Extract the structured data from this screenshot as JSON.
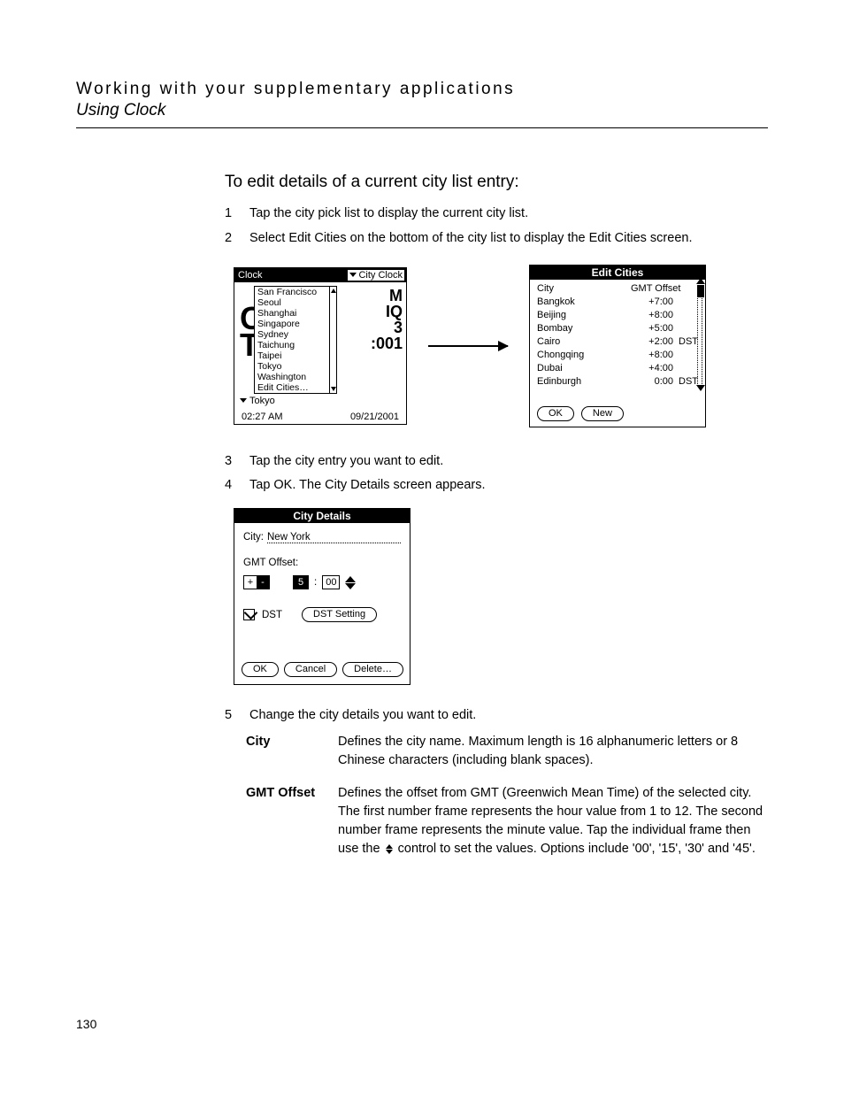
{
  "header": {
    "title": "Working with your supplementary applications",
    "subtitle": "Using Clock"
  },
  "h3": "To edit details of a current city list entry:",
  "steps_a": [
    {
      "n": "1",
      "t": "Tap the city pick list to display the current city list."
    },
    {
      "n": "2",
      "t": "Select Edit Cities on the bottom of the city list to display the Edit Cities screen."
    }
  ],
  "clock": {
    "title": "Clock",
    "menu": "City Clock",
    "list": [
      "San Francisco",
      "Seoul",
      "Shanghai",
      "Singapore",
      "Sydney",
      "Taichung",
      "Taipei",
      "Tokyo",
      "Washington",
      "Edit Cities…"
    ],
    "current": "Tokyo",
    "time": "02:27 AM",
    "date": "09/21/2001",
    "glyphs": [
      "M",
      "IQ",
      "",
      "3",
      ":001"
    ],
    "bigletters": "C\nT"
  },
  "edit_cities": {
    "title": "Edit Cities",
    "head_city": "City",
    "head_off": "GMT Offset",
    "rows": [
      {
        "city": "Bangkok",
        "off": "+7:00",
        "dst": ""
      },
      {
        "city": "Beijing",
        "off": "+8:00",
        "dst": ""
      },
      {
        "city": "Bombay",
        "off": "+5:00",
        "dst": ""
      },
      {
        "city": "Cairo",
        "off": "+2:00",
        "dst": "DST"
      },
      {
        "city": "Chongqing",
        "off": "+8:00",
        "dst": ""
      },
      {
        "city": "Dubai",
        "off": "+4:00",
        "dst": ""
      },
      {
        "city": "Edinburgh",
        "off": "0:00",
        "dst": "DST"
      }
    ],
    "ok": "OK",
    "new": "New"
  },
  "steps_b": [
    {
      "n": "3",
      "t": "Tap the city entry you want to edit."
    },
    {
      "n": "4",
      "t": "Tap OK. The City Details screen appears."
    }
  ],
  "city_details": {
    "title": "City Details",
    "city_label": "City:",
    "city_value": "New York",
    "gmt_label": "GMT Offset:",
    "sign_plus": "+",
    "sign_minus": "-",
    "hour": "5",
    "sep": ":",
    "minute": "00",
    "dst_label": "DST",
    "dst_setting": "DST Setting",
    "ok": "OK",
    "cancel": "Cancel",
    "delete": "Delete…"
  },
  "steps_c": [
    {
      "n": "5",
      "t": "Change the city details you want to edit."
    }
  ],
  "defs": {
    "city_term": "City",
    "city_desc": "Defines the city name. Maximum length is 16 alphanumeric letters or 8 Chinese characters (including blank spaces).",
    "gmt_term": "GMT Offset",
    "gmt_desc_a": "Defines the offset from GMT (Greenwich Mean Time) of the selected city. The first number frame represents the hour value from 1 to 12. The second number frame represents the minute value. Tap the individual frame then use the ",
    "gmt_desc_b": " control to set the values. Options include '00', '15', '30' and '45'."
  },
  "page_number": "130"
}
